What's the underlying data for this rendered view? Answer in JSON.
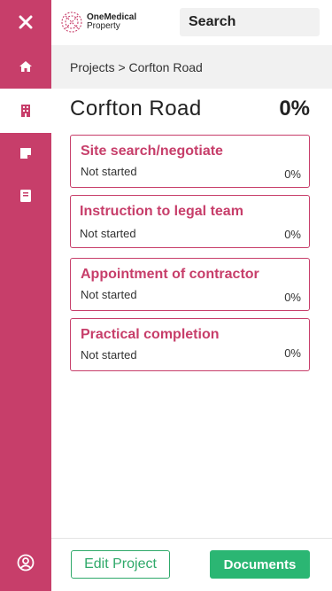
{
  "header": {
    "logo_line1": "OneMedical",
    "logo_line2": "Property",
    "search_placeholder": "Search"
  },
  "sidebar": {
    "items": [
      {
        "icon": "close-icon"
      },
      {
        "icon": "home-icon"
      },
      {
        "icon": "building-icon",
        "active": true
      },
      {
        "icon": "note-icon"
      },
      {
        "icon": "book-icon"
      },
      {
        "icon": "account-icon"
      }
    ]
  },
  "breadcrumb": "Projects > Corfton Road",
  "project": {
    "title": "Corfton Road",
    "percent": "0%"
  },
  "stages": [
    {
      "title": "Site search/negotiate",
      "status": "Not started",
      "percent": "0%"
    },
    {
      "title": "Instruction to legal team",
      "status": "Not started",
      "percent": "0%"
    },
    {
      "title": "Appointment of contractor",
      "status": "Not started",
      "percent": "0%"
    },
    {
      "title": "Practical completion",
      "status": "Not started",
      "percent": "0%"
    }
  ],
  "footer": {
    "edit_label": "Edit Project",
    "documents_label": "Documents"
  },
  "colors": {
    "brand": "#c73e6a",
    "accent_green": "#2bb673"
  }
}
